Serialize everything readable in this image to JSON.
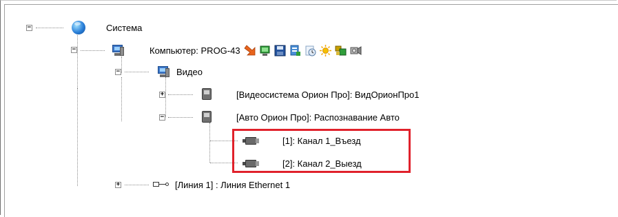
{
  "tree": {
    "root": {
      "label": "Система",
      "icon": "globe-icon"
    },
    "computer": {
      "label": "Компьютер: PROG-43",
      "toolbar_icons": [
        {
          "name": "arrow-event-icon",
          "color": "#e8641c"
        },
        {
          "name": "monitor-green-icon",
          "color": "#2f9e3a"
        },
        {
          "name": "save-disk-icon",
          "color": "#24539e"
        },
        {
          "name": "document-blue-icon",
          "color": "#4a8fd6"
        },
        {
          "name": "clock-icon",
          "color": "#a8c8e8"
        },
        {
          "name": "sun-icon",
          "color": "#f5c000"
        },
        {
          "name": "modules-icon",
          "color": "#c8a000"
        },
        {
          "name": "camera-gray-icon",
          "color": "#9a9a9a"
        }
      ]
    },
    "video": {
      "label": "Видео"
    },
    "video_system": {
      "label": "[Видеосистема Орион Про]: ВидОрионПро1"
    },
    "auto_orion": {
      "label": "[Авто Орион Про]: Распознавание Авто"
    },
    "channels": [
      {
        "label": "[1]: Канал 1_Въезд"
      },
      {
        "label": "[2]: Канал 2_Выезд"
      }
    ],
    "line": {
      "label": "[Линия 1] : Линия Ethernet 1"
    }
  },
  "highlight_color": "#e0212b"
}
